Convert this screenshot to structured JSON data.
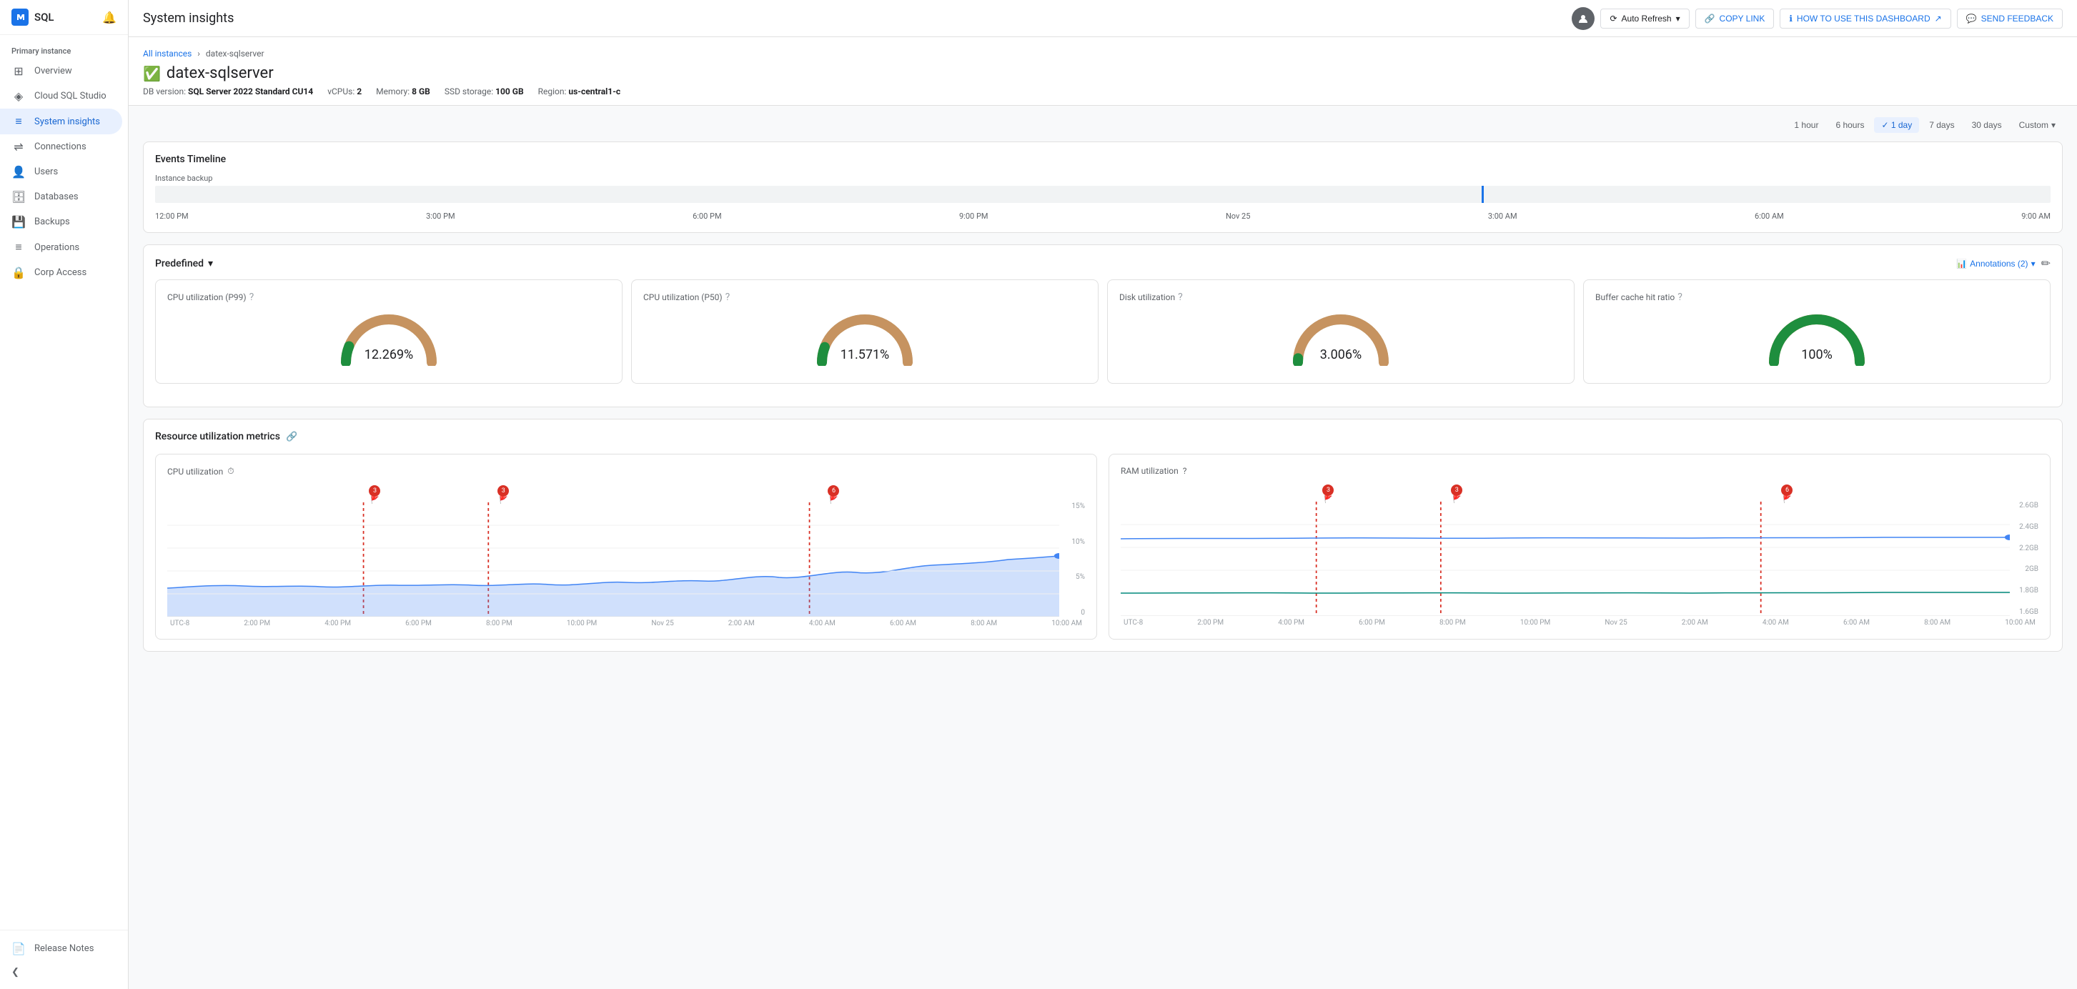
{
  "app": {
    "name": "SQL",
    "title": "System insights"
  },
  "sidebar": {
    "section_label": "Primary instance",
    "items": [
      {
        "id": "overview",
        "label": "Overview",
        "icon": "⊞",
        "active": false
      },
      {
        "id": "cloud-sql-studio",
        "label": "Cloud SQL Studio",
        "icon": "◈",
        "active": false
      },
      {
        "id": "system-insights",
        "label": "System insights",
        "icon": "≡",
        "active": true
      },
      {
        "id": "connections",
        "label": "Connections",
        "icon": "⇌",
        "active": false
      },
      {
        "id": "users",
        "label": "Users",
        "icon": "👤",
        "active": false
      },
      {
        "id": "databases",
        "label": "Databases",
        "icon": "🗄",
        "active": false
      },
      {
        "id": "backups",
        "label": "Backups",
        "icon": "💾",
        "active": false
      },
      {
        "id": "operations",
        "label": "Operations",
        "icon": "≡",
        "active": false
      },
      {
        "id": "corp-access",
        "label": "Corp Access",
        "icon": "🔒",
        "active": false
      }
    ],
    "bottom": {
      "release_notes": "Release Notes",
      "collapse_icon": "❮"
    }
  },
  "topbar": {
    "auto_refresh": "Auto Refresh",
    "copy_link": "COPY LINK",
    "how_to_use": "HOW TO USE THIS DASHBOARD",
    "send_feedback": "SEND FEEDBACK"
  },
  "instance": {
    "breadcrumb_all": "All instances",
    "breadcrumb_sep": "›",
    "breadcrumb_current": "datex-sqlserver",
    "name": "datex-sqlserver",
    "db_version_label": "DB version:",
    "db_version": "SQL Server 2022 Standard CU14",
    "vcpus_label": "vCPUs:",
    "vcpus": "2",
    "memory_label": "Memory:",
    "memory": "8 GB",
    "storage_label": "SSD storage:",
    "storage": "100 GB",
    "region_label": "Region:",
    "region": "us-central1-c"
  },
  "time_range": {
    "options": [
      "1 hour",
      "6 hours",
      "1 day",
      "7 days",
      "30 days"
    ],
    "active": "1 day",
    "custom": "Custom"
  },
  "events_timeline": {
    "title": "Events Timeline",
    "label": "Instance backup",
    "axis_labels": [
      "12:00 PM",
      "3:00 PM",
      "6:00 PM",
      "9:00 PM",
      "Nov 25",
      "3:00 AM",
      "6:00 AM",
      "9:00 AM"
    ]
  },
  "predefined": {
    "title": "Predefined",
    "annotations_label": "Annotations (2)",
    "gauges": [
      {
        "id": "cpu-p99",
        "title": "CPU utilization (P99)",
        "value": "12.269%",
        "color_main": "#1e8e3e",
        "color_warn": "#f9ab00",
        "color_crit": "#d93025",
        "percent": 12.269
      },
      {
        "id": "cpu-p50",
        "title": "CPU utilization (P50)",
        "value": "11.571%",
        "color_main": "#1e8e3e",
        "color_warn": "#f9ab00",
        "color_crit": "#d93025",
        "percent": 11.571
      },
      {
        "id": "disk-util",
        "title": "Disk utilization",
        "value": "3.006%",
        "color_main": "#1e8e3e",
        "color_warn": "#f9ab00",
        "color_crit": "#d93025",
        "percent": 3.006
      },
      {
        "id": "buffer-cache",
        "title": "Buffer cache hit ratio",
        "value": "100%",
        "color_main": "#1e8e3e",
        "color_warn": "#f9ab00",
        "color_crit": "#d93025",
        "percent": 100
      }
    ]
  },
  "resource_metrics": {
    "title": "Resource utilization metrics",
    "cpu_chart": {
      "title": "CPU utilization",
      "y_labels": [
        "15%",
        "10%",
        "5%",
        "0"
      ],
      "x_labels": [
        "UTC-8",
        "2:00 PM",
        "4:00 PM",
        "6:00 PM",
        "8:00 PM",
        "10:00 PM",
        "Nov 25",
        "2:00 AM",
        "4:00 AM",
        "6:00 AM",
        "8:00 AM",
        "10:00 AM"
      ],
      "alerts": [
        {
          "label": "3",
          "position": 22
        },
        {
          "label": "3",
          "position": 36
        },
        {
          "label": "6",
          "position": 72
        }
      ]
    },
    "ram_chart": {
      "title": "RAM utilization",
      "y_labels": [
        "2.6GB",
        "2.4GB",
        "2.2GB",
        "2GB",
        "1.8GB",
        "1.6GB"
      ],
      "x_labels": [
        "UTC-8",
        "2:00 PM",
        "4:00 PM",
        "6:00 PM",
        "8:00 PM",
        "10:00 PM",
        "Nov 25",
        "2:00 AM",
        "4:00 AM",
        "6:00 AM",
        "8:00 AM",
        "10:00 AM"
      ],
      "alerts": [
        {
          "label": "3",
          "position": 22
        },
        {
          "label": "3",
          "position": 36
        },
        {
          "label": "6",
          "position": 72
        }
      ]
    }
  },
  "colors": {
    "accent": "#1a73e8",
    "active_nav_bg": "#e8f0fe",
    "active_nav_text": "#1967d2",
    "green": "#1e8e3e",
    "orange": "#f9ab00",
    "red": "#d93025",
    "blue_chart": "#4285f4",
    "blue_chart_fill": "rgba(66,133,244,0.3)"
  }
}
